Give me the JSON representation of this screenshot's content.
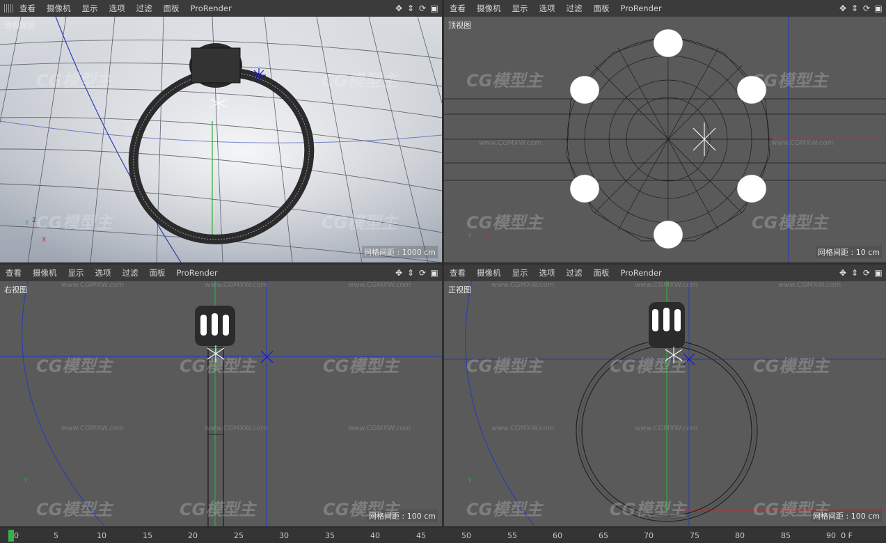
{
  "menu": [
    "查看",
    "摄像机",
    "显示",
    "选项",
    "过滤",
    "面板",
    "ProRender"
  ],
  "viewports": {
    "persp": {
      "label": "透视视图",
      "grid": "网格间距 : 1000 cm"
    },
    "top": {
      "label": "顶视图",
      "grid": "网格间距 : 10 cm"
    },
    "right": {
      "label": "右视图",
      "grid": "网格间距 : 100 cm"
    },
    "front": {
      "label": "正视图",
      "grid": "网格间距 : 100 cm"
    }
  },
  "watermark": {
    "logo": "CG模型主",
    "url": "www.CGMXW.com"
  },
  "timeline": {
    "ticks": [
      "0",
      "5",
      "10",
      "15",
      "20",
      "25",
      "30",
      "35",
      "40",
      "45",
      "50",
      "55",
      "60",
      "65",
      "70",
      "75",
      "80",
      "85",
      "90"
    ],
    "frame": "0 F"
  },
  "axes": {
    "x": "X",
    "y": "Y",
    "z": "Z"
  },
  "colors": {
    "panel": "#5a5a5a",
    "menubar": "#3b3b3b",
    "axis_blue": "#2b3fb0",
    "axis_green": "#2fae3a",
    "axis_red": "#b83232",
    "playhead": "#36b24a"
  }
}
